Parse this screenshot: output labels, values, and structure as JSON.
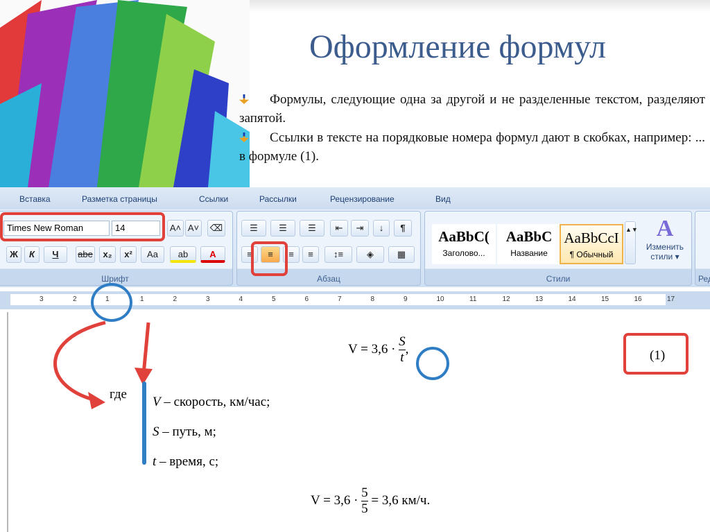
{
  "slide": {
    "title": "Оформление формул",
    "bullets": [
      "Формулы, следующие одна за другой и не разделенные текстом, разделяют запятой.",
      "Ссылки в тексте на порядковые номера формул дают в скобках, например: ... в формуле (1)."
    ]
  },
  "word": {
    "tabs": [
      "Вставка",
      "Разметка страницы",
      "Ссылки",
      "Рассылки",
      "Рецензирование",
      "Вид"
    ],
    "font": {
      "name": "Times New Roman",
      "size": "14",
      "group": "Шрифт",
      "bold": "Ж",
      "italic": "К",
      "underline": "Ч",
      "strike": "abe",
      "sub": "x₂",
      "sup": "x²",
      "case": "Aa",
      "grow": "A˄",
      "shrink": "A˅"
    },
    "paragraph": {
      "group": "Абзац",
      "pilcrow": "¶"
    },
    "styles": {
      "group": "Стили",
      "items": [
        {
          "sample": "AaBbC(",
          "name": "Заголово..."
        },
        {
          "sample": "AaBbC",
          "name": "Название"
        },
        {
          "sample": "AaBbCcI",
          "name": "¶ Обычный"
        }
      ],
      "change": "Изменить стили ▾"
    },
    "edit_group": "Ред",
    "ruler": [
      "3",
      "2",
      "1",
      "1",
      "2",
      "3",
      "4",
      "5",
      "6",
      "7",
      "8",
      "9",
      "10",
      "11",
      "12",
      "13",
      "14",
      "15",
      "16",
      "17"
    ],
    "doc": {
      "formula1": {
        "lhs": "V = 3,6 ·",
        "num": "S",
        "den": "t",
        "tail": ",",
        "number": "(1)"
      },
      "where": "где",
      "defs": [
        {
          "var": "V",
          "text": " – скорость, км/час;"
        },
        {
          "var": "S",
          "text": " – путь, м;"
        },
        {
          "var": "t",
          "text": " – время, с;"
        }
      ],
      "formula2": {
        "lhs": "V = 3,6 ·",
        "num": "5",
        "den": "5",
        "tail": "= 3,6 км/ч."
      }
    }
  },
  "colors": {
    "title": "#3b5c8c",
    "highlight_red": "#e0413a",
    "highlight_blue": "#2f7dc4"
  }
}
